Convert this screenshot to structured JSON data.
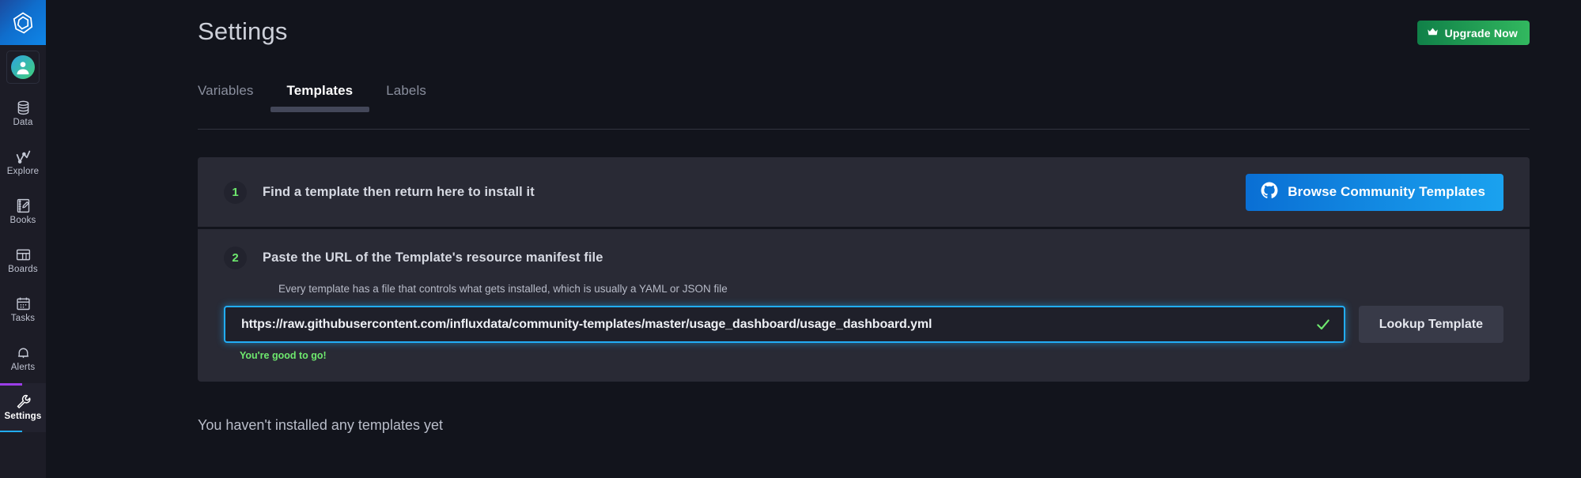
{
  "sidebar": {
    "logo_icon": "influxdata-logo-icon",
    "avatar_icon": "user-avatar-icon",
    "items": [
      {
        "label": "Data",
        "icon": "database-icon",
        "active": false
      },
      {
        "label": "Explore",
        "icon": "line-graph-icon",
        "active": false
      },
      {
        "label": "Books",
        "icon": "notebook-pencil-icon",
        "active": false
      },
      {
        "label": "Boards",
        "icon": "dashboard-grid-icon",
        "active": false
      },
      {
        "label": "Tasks",
        "icon": "calendar-icon",
        "active": false
      },
      {
        "label": "Alerts",
        "icon": "bell-icon",
        "active": false
      },
      {
        "label": "Settings",
        "icon": "wrench-icon",
        "active": true
      }
    ]
  },
  "header": {
    "title": "Settings",
    "upgrade_label": "Upgrade Now",
    "upgrade_icon": "crown-icon"
  },
  "tabs": [
    {
      "label": "Variables",
      "active": false
    },
    {
      "label": "Templates",
      "active": true
    },
    {
      "label": "Labels",
      "active": false
    }
  ],
  "steps": {
    "step1": {
      "number": "1",
      "title": "Find a template then return here to install it",
      "browse_label": "Browse Community Templates",
      "browse_icon": "github-icon"
    },
    "step2": {
      "number": "2",
      "title": "Paste the URL of the Template's resource manifest file",
      "description": "Every template has a file that controls what gets installed, which is usually a YAML or JSON file",
      "url_value": "https://raw.githubusercontent.com/influxdata/community-templates/master/usage_dashboard/usage_dashboard.yml",
      "url_placeholder": "https://raw.githubusercontent.com/influxdata/community-templates/master/",
      "valid_icon": "checkmark-icon",
      "helper_text": "You're good to go!",
      "lookup_label": "Lookup Template"
    }
  },
  "empty_state": "You haven't installed any templates yet",
  "colors": {
    "accent_blue": "#22adf6",
    "accent_green": "#6ee86e",
    "panel_bg": "#292a35",
    "page_bg": "#12141c",
    "sidebar_bg": "#1c1c26"
  }
}
